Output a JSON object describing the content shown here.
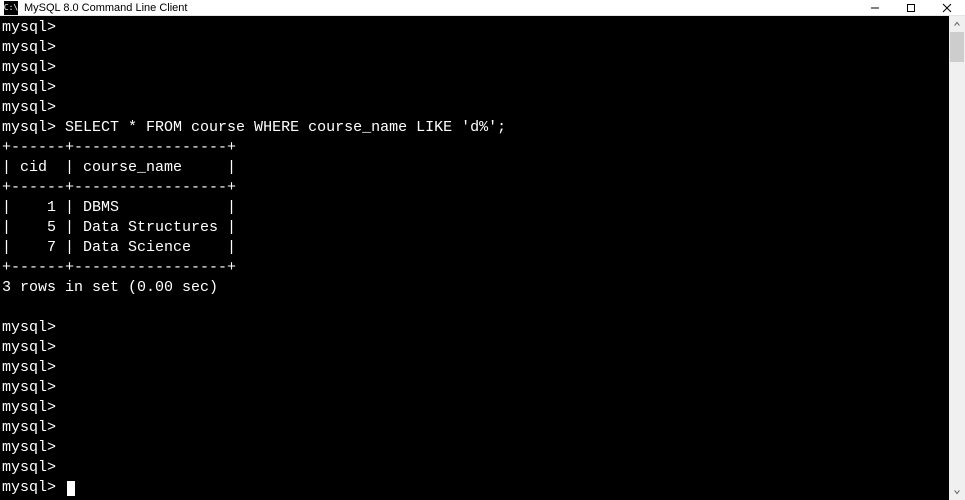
{
  "window": {
    "icon_label": "C:\\",
    "title": "MySQL 8.0 Command Line Client"
  },
  "terminal": {
    "prompt": "mysql>",
    "query": "SELECT * FROM course WHERE course_name LIKE 'd%';",
    "table": {
      "top_border": "+------+-----------------+",
      "header_row": "| cid  | course_name     |",
      "header_border": "+------+-----------------+",
      "rows": [
        "|    1 | DBMS            |",
        "|    5 | Data Structures |",
        "|    7 | Data Science    |"
      ],
      "bottom_border": "+------+-----------------+"
    },
    "result_summary": "3 rows in set (0.00 sec)",
    "empty_prompt_count_before": 5,
    "empty_prompt_count_after": 9
  },
  "chart_data": {
    "type": "table",
    "columns": [
      "cid",
      "course_name"
    ],
    "rows": [
      {
        "cid": 1,
        "course_name": "DBMS"
      },
      {
        "cid": 5,
        "course_name": "Data Structures"
      },
      {
        "cid": 7,
        "course_name": "Data Science"
      }
    ],
    "summary": "3 rows in set (0.00 sec)"
  }
}
